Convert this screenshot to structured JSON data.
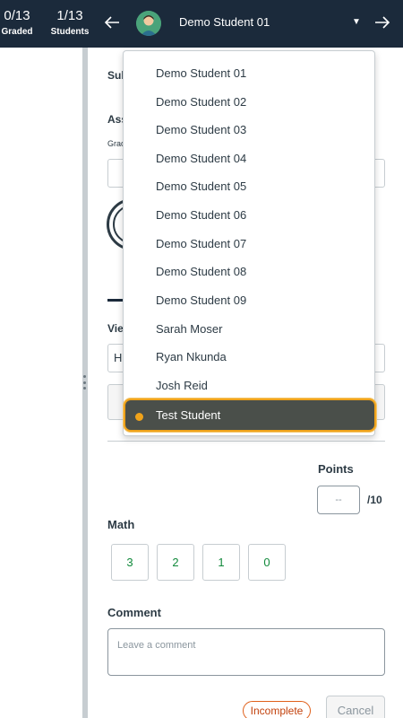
{
  "header": {
    "graded_count": "0/13",
    "graded_label": "Graded",
    "students_count": "1/13",
    "students_label": "Students",
    "current_student": "Demo Student 01"
  },
  "background": {
    "submission_label_partial": "Sub",
    "assessment_label_partial": "Ass",
    "grade_label_partial": "Grad",
    "view_label_partial": "Vie",
    "view_select_partial": "H"
  },
  "student_menu": {
    "items": [
      "Demo Student 01",
      "Demo Student 02",
      "Demo Student 03",
      "Demo Student 04",
      "Demo Student 05",
      "Demo Student 06",
      "Demo Student 07",
      "Demo Student 08",
      "Demo Student 09",
      "Sarah Moser",
      "Ryan Nkunda",
      "Josh Reid"
    ],
    "highlighted": "Test Student"
  },
  "grading": {
    "points_label": "Points",
    "points_placeholder": "--",
    "points_max": "/10",
    "rubric_label": "Math",
    "rubric_scores": [
      "3",
      "2",
      "1",
      "0"
    ],
    "comment_label": "Comment",
    "comment_placeholder": "Leave a comment",
    "status": "Incomplete",
    "cancel_label": "Cancel"
  },
  "colors": {
    "topbar": "#1b2a3b",
    "highlight_bg": "#4a4f4a",
    "highlight_border": "#f0a31a",
    "score_text": "#128a3c",
    "status_border": "#e0601b"
  }
}
